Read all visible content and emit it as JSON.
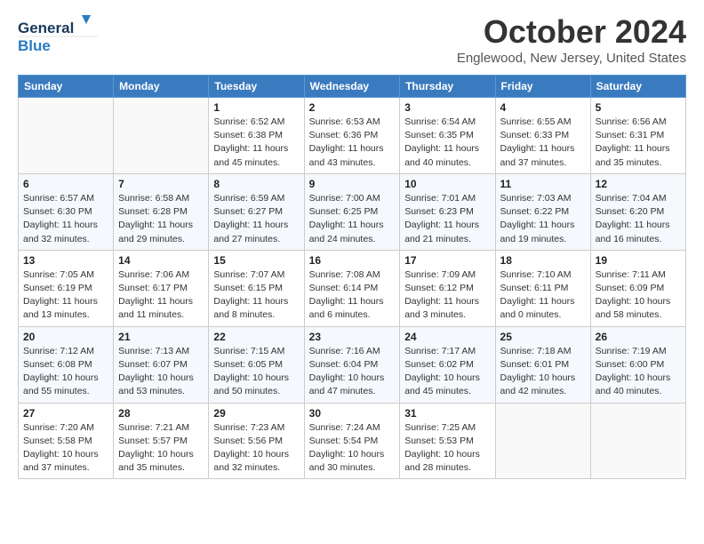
{
  "header": {
    "month_title": "October 2024",
    "location": "Englewood, New Jersey, United States",
    "logo_line1": "General",
    "logo_line2": "Blue"
  },
  "days_of_week": [
    "Sunday",
    "Monday",
    "Tuesday",
    "Wednesday",
    "Thursday",
    "Friday",
    "Saturday"
  ],
  "weeks": [
    [
      {
        "day": "",
        "info": ""
      },
      {
        "day": "",
        "info": ""
      },
      {
        "day": "1",
        "info": "Sunrise: 6:52 AM\nSunset: 6:38 PM\nDaylight: 11 hours and 45 minutes."
      },
      {
        "day": "2",
        "info": "Sunrise: 6:53 AM\nSunset: 6:36 PM\nDaylight: 11 hours and 43 minutes."
      },
      {
        "day": "3",
        "info": "Sunrise: 6:54 AM\nSunset: 6:35 PM\nDaylight: 11 hours and 40 minutes."
      },
      {
        "day": "4",
        "info": "Sunrise: 6:55 AM\nSunset: 6:33 PM\nDaylight: 11 hours and 37 minutes."
      },
      {
        "day": "5",
        "info": "Sunrise: 6:56 AM\nSunset: 6:31 PM\nDaylight: 11 hours and 35 minutes."
      }
    ],
    [
      {
        "day": "6",
        "info": "Sunrise: 6:57 AM\nSunset: 6:30 PM\nDaylight: 11 hours and 32 minutes."
      },
      {
        "day": "7",
        "info": "Sunrise: 6:58 AM\nSunset: 6:28 PM\nDaylight: 11 hours and 29 minutes."
      },
      {
        "day": "8",
        "info": "Sunrise: 6:59 AM\nSunset: 6:27 PM\nDaylight: 11 hours and 27 minutes."
      },
      {
        "day": "9",
        "info": "Sunrise: 7:00 AM\nSunset: 6:25 PM\nDaylight: 11 hours and 24 minutes."
      },
      {
        "day": "10",
        "info": "Sunrise: 7:01 AM\nSunset: 6:23 PM\nDaylight: 11 hours and 21 minutes."
      },
      {
        "day": "11",
        "info": "Sunrise: 7:03 AM\nSunset: 6:22 PM\nDaylight: 11 hours and 19 minutes."
      },
      {
        "day": "12",
        "info": "Sunrise: 7:04 AM\nSunset: 6:20 PM\nDaylight: 11 hours and 16 minutes."
      }
    ],
    [
      {
        "day": "13",
        "info": "Sunrise: 7:05 AM\nSunset: 6:19 PM\nDaylight: 11 hours and 13 minutes."
      },
      {
        "day": "14",
        "info": "Sunrise: 7:06 AM\nSunset: 6:17 PM\nDaylight: 11 hours and 11 minutes."
      },
      {
        "day": "15",
        "info": "Sunrise: 7:07 AM\nSunset: 6:15 PM\nDaylight: 11 hours and 8 minutes."
      },
      {
        "day": "16",
        "info": "Sunrise: 7:08 AM\nSunset: 6:14 PM\nDaylight: 11 hours and 6 minutes."
      },
      {
        "day": "17",
        "info": "Sunrise: 7:09 AM\nSunset: 6:12 PM\nDaylight: 11 hours and 3 minutes."
      },
      {
        "day": "18",
        "info": "Sunrise: 7:10 AM\nSunset: 6:11 PM\nDaylight: 11 hours and 0 minutes."
      },
      {
        "day": "19",
        "info": "Sunrise: 7:11 AM\nSunset: 6:09 PM\nDaylight: 10 hours and 58 minutes."
      }
    ],
    [
      {
        "day": "20",
        "info": "Sunrise: 7:12 AM\nSunset: 6:08 PM\nDaylight: 10 hours and 55 minutes."
      },
      {
        "day": "21",
        "info": "Sunrise: 7:13 AM\nSunset: 6:07 PM\nDaylight: 10 hours and 53 minutes."
      },
      {
        "day": "22",
        "info": "Sunrise: 7:15 AM\nSunset: 6:05 PM\nDaylight: 10 hours and 50 minutes."
      },
      {
        "day": "23",
        "info": "Sunrise: 7:16 AM\nSunset: 6:04 PM\nDaylight: 10 hours and 47 minutes."
      },
      {
        "day": "24",
        "info": "Sunrise: 7:17 AM\nSunset: 6:02 PM\nDaylight: 10 hours and 45 minutes."
      },
      {
        "day": "25",
        "info": "Sunrise: 7:18 AM\nSunset: 6:01 PM\nDaylight: 10 hours and 42 minutes."
      },
      {
        "day": "26",
        "info": "Sunrise: 7:19 AM\nSunset: 6:00 PM\nDaylight: 10 hours and 40 minutes."
      }
    ],
    [
      {
        "day": "27",
        "info": "Sunrise: 7:20 AM\nSunset: 5:58 PM\nDaylight: 10 hours and 37 minutes."
      },
      {
        "day": "28",
        "info": "Sunrise: 7:21 AM\nSunset: 5:57 PM\nDaylight: 10 hours and 35 minutes."
      },
      {
        "day": "29",
        "info": "Sunrise: 7:23 AM\nSunset: 5:56 PM\nDaylight: 10 hours and 32 minutes."
      },
      {
        "day": "30",
        "info": "Sunrise: 7:24 AM\nSunset: 5:54 PM\nDaylight: 10 hours and 30 minutes."
      },
      {
        "day": "31",
        "info": "Sunrise: 7:25 AM\nSunset: 5:53 PM\nDaylight: 10 hours and 28 minutes."
      },
      {
        "day": "",
        "info": ""
      },
      {
        "day": "",
        "info": ""
      }
    ]
  ]
}
